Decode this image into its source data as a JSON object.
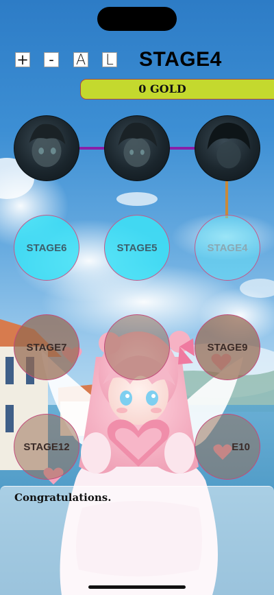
{
  "header": {
    "controls": [
      {
        "label": "+",
        "name": "zoom-in-button"
      },
      {
        "label": "-",
        "name": "zoom-out-button"
      },
      {
        "label": "A",
        "name": "auto-button"
      },
      {
        "label": "L",
        "name": "log-button"
      }
    ],
    "stage_title": "STAGE4",
    "gold": "0 GOLD"
  },
  "stages": [
    {
      "id": "portrait-1",
      "label": "",
      "state": "portrait"
    },
    {
      "id": "portrait-2",
      "label": "",
      "state": "portrait"
    },
    {
      "id": "portrait-3",
      "label": "",
      "state": "portrait"
    },
    {
      "id": "stage6",
      "label": "STAGE6",
      "state": "cleared"
    },
    {
      "id": "stage5",
      "label": "STAGE5",
      "state": "cleared"
    },
    {
      "id": "stage4",
      "label": "STAGE4",
      "state": "current"
    },
    {
      "id": "stage7",
      "label": "STAGE7",
      "state": "locked"
    },
    {
      "id": "stage8",
      "label": "",
      "state": "locked"
    },
    {
      "id": "stage9",
      "label": "STAGE9",
      "state": "locked"
    },
    {
      "id": "stage12",
      "label": "STAGE12",
      "state": "locked"
    },
    {
      "id": "stage10",
      "label": "E10",
      "state": "locked"
    }
  ],
  "dialog": {
    "message": "Congratulations."
  },
  "colors": {
    "gold_bar": "#c4d92e",
    "cleared_node": "#3ce0f6",
    "link_purple": "#8a1fa8",
    "link_orange": "#c98a3a"
  }
}
